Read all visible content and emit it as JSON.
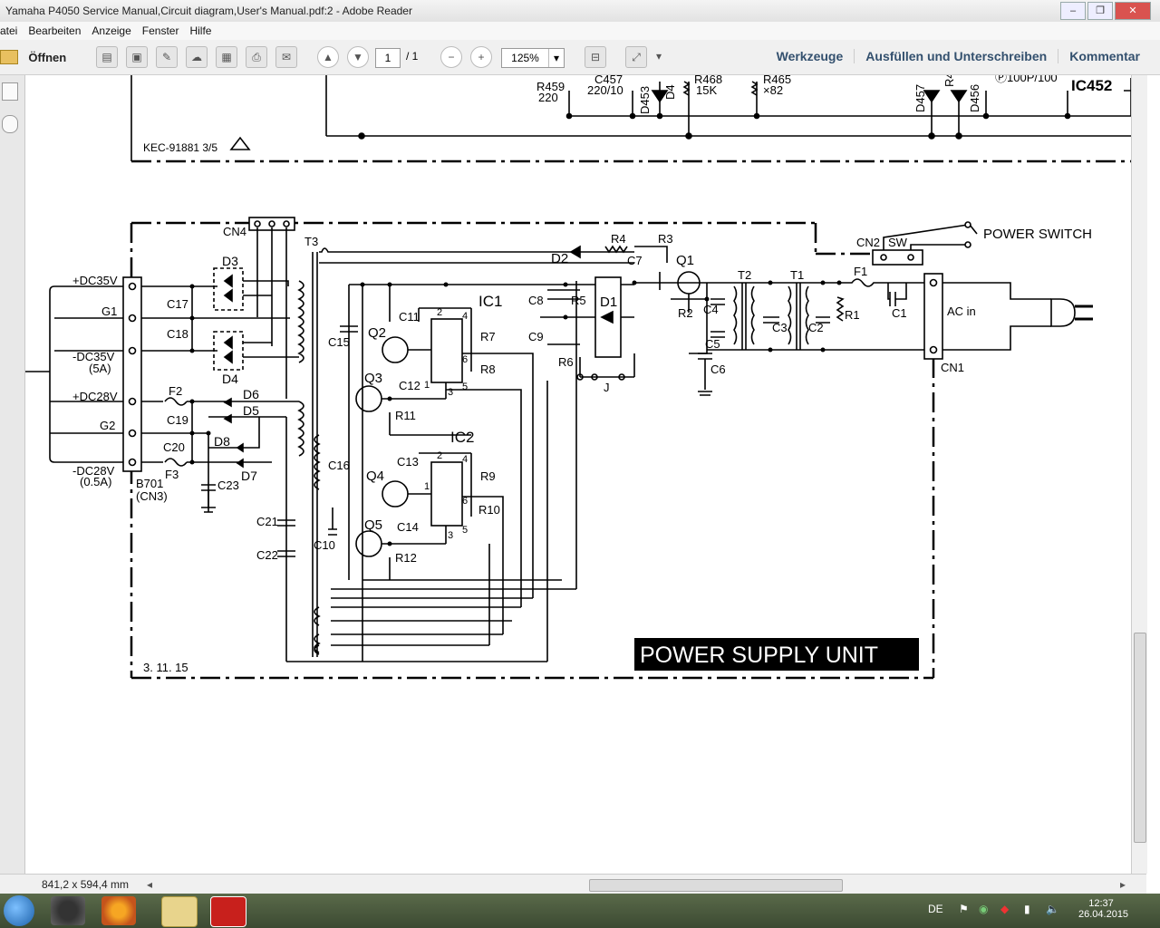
{
  "window": {
    "title": "Yamaha P4050 Service Manual,Circuit diagram,User's Manual.pdf:2 - Adobe Reader",
    "buttons": [
      "–",
      "❐",
      "✕"
    ]
  },
  "menu": {
    "items": [
      "atei",
      "Bearbeiten",
      "Anzeige",
      "Fenster",
      "Hilfe"
    ]
  },
  "toolbar": {
    "open_label": "Öffnen",
    "page_current": "1",
    "page_total": "/ 1",
    "zoom": "125%",
    "links": [
      "Werkzeuge",
      "Ausfüllen und Unterschreiben",
      "Kommentar"
    ]
  },
  "status": {
    "dims": "841,2 x 594,4 mm"
  },
  "taskbar": {
    "lang": "DE",
    "time": "12:37",
    "date": "26.04.2015"
  },
  "schematic": {
    "top_labels": {
      "r459": "R459",
      "r459v": "220",
      "c457": "C457",
      "c457v": "220/10",
      "d453": "D453",
      "d4x": "D4",
      "r468": "R468",
      "r468v": "15K",
      "r465": "R465",
      "r465v": "×82",
      "d457": "D457",
      "d456": "D456",
      "r4x": "R4",
      "p100": "Ⓟ100P/100",
      "ic452": "IC452",
      "kec": "KEC-91881 3/5"
    },
    "title": "POWER SUPPLY UNIT",
    "date": "3. 11. 15",
    "labels": {
      "cn4": "CN4",
      "t3": "T3",
      "d2": "D2",
      "r4": "R4",
      "r3": "R3",
      "q1": "Q1",
      "c7": "C7",
      "r2": "R2",
      "c4": "C4",
      "c5": "C5",
      "c6": "C6",
      "t2": "T2",
      "t1": "T1",
      "c3": "C3",
      "c2": "C2",
      "r1": "R1",
      "f1": "F1",
      "c1": "C1",
      "cn2": "CN2",
      "sw": "SW",
      "power_switch": "POWER SWITCH",
      "ac_in": "AC in",
      "cn1": "CN1",
      "dc35p": "+DC35V",
      "g1": "G1",
      "dc35n": "-DC35V",
      "dc35na": "(5A)",
      "dc28p": "+DC28V",
      "g2": "G2",
      "dc28n": "-DC28V",
      "dc28na": "(0.5A)",
      "b701": "B701",
      "cn3": "(CN3)",
      "d3": "D3",
      "d4": "D4",
      "c17": "C17",
      "c18": "C18",
      "f2": "F2",
      "f3": "F3",
      "d6": "D6",
      "d5": "D5",
      "d8": "D8",
      "d7": "D7",
      "c19": "C19",
      "c20": "C20",
      "c23": "C23",
      "c21": "C21",
      "c22": "C22",
      "c15": "C15",
      "c16": "C16",
      "c10": "C10",
      "q2": "Q2",
      "q3": "Q3",
      "q4": "Q4",
      "q5": "Q5",
      "ic1": "IC1",
      "ic2": "IC2",
      "c11": "C11",
      "c12": "C12",
      "c13": "C13",
      "c14": "C14",
      "r7": "R7",
      "r8": "R8",
      "r9": "R9",
      "r10": "R10",
      "r11": "R11",
      "r12": "R12",
      "c8": "C8",
      "c9": "C9",
      "r5": "R5",
      "r6": "R6",
      "d1": "D1",
      "j": "J",
      "p1": "1",
      "p2": "2",
      "p3": "3",
      "p4": "4",
      "p5": "5",
      "p6": "6",
      "p1b": "1",
      "p2b": "2",
      "p3b": "3",
      "p4b": "4",
      "p5b": "5",
      "p6b": "6"
    }
  }
}
